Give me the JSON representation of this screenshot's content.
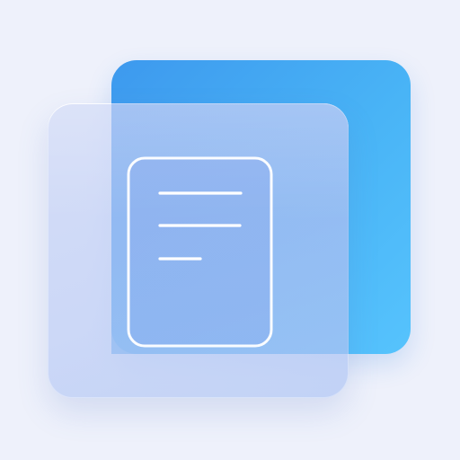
{
  "app_icon": {
    "icon": "document-icon",
    "colors": {
      "background": "#eef1fb",
      "back_card": "#49b4f6",
      "front_card": "#c6d3f5",
      "document_stroke": "#ffffff"
    }
  }
}
